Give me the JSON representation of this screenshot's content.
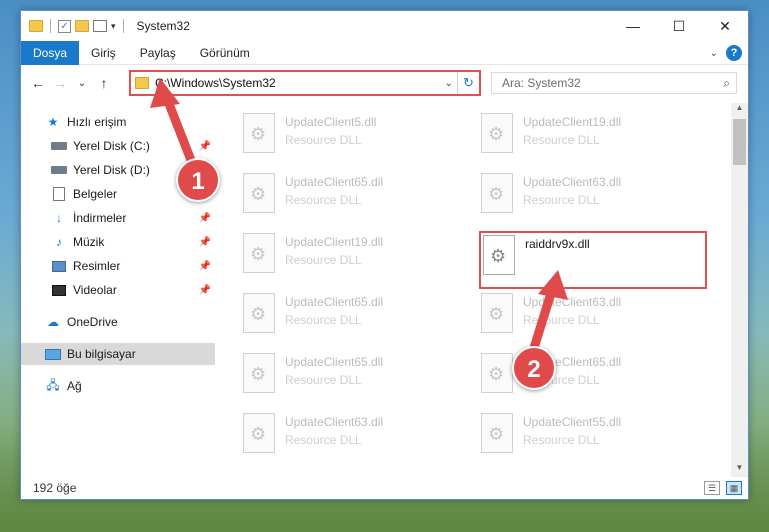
{
  "window": {
    "title": "System32"
  },
  "ribbon": {
    "tabs": [
      "Dosya",
      "Giriş",
      "Paylaş",
      "Görünüm"
    ]
  },
  "address": {
    "path": "C:\\Windows\\System32",
    "search_placeholder": "Ara: System32"
  },
  "sidebar": {
    "items": [
      {
        "label": "Hızlı erişim",
        "icon": "star-icon",
        "pinned": false
      },
      {
        "label": "Yerel Disk (C:)",
        "icon": "drive-icon",
        "pinned": true
      },
      {
        "label": "Yerel Disk (D:)",
        "icon": "drive-icon",
        "pinned": false
      },
      {
        "label": "Belgeler",
        "icon": "document-icon",
        "pinned": false
      },
      {
        "label": "İndirmeler",
        "icon": "download-icon",
        "pinned": true
      },
      {
        "label": "Müzik",
        "icon": "music-icon",
        "pinned": true
      },
      {
        "label": "Resimler",
        "icon": "pictures-icon",
        "pinned": true
      },
      {
        "label": "Videolar",
        "icon": "video-icon",
        "pinned": true
      },
      {
        "label": "OneDrive",
        "icon": "cloud-icon",
        "pinned": false
      },
      {
        "label": "Bu bilgisayar",
        "icon": "computer-icon",
        "pinned": false,
        "selected": true
      },
      {
        "label": "Ağ",
        "icon": "network-icon",
        "pinned": false
      }
    ]
  },
  "files": [
    {
      "name": "UpdateClient5.dll",
      "type": "Resource DLL"
    },
    {
      "name": "UpdateClient19.dll",
      "type": "Resource DLL"
    },
    {
      "name": "UpdateClient65.dll",
      "type": "Resource DLL"
    },
    {
      "name": "UpdateClient63.dll",
      "type": "Resource DLL"
    },
    {
      "name": "UpdateClient19.dll",
      "type": "Resource DLL"
    },
    {
      "name": "raiddrv9x.dll",
      "type": "",
      "highlighted": true
    },
    {
      "name": "UpdateClient65.dll",
      "type": "Resource DLL"
    },
    {
      "name": "UpdateClient63.dll",
      "type": "Resource DLL"
    },
    {
      "name": "UpdateClient65.dll",
      "type": "Resource DLL"
    },
    {
      "name": "UpdateClient65.dll",
      "type": "Resource DLL"
    },
    {
      "name": "UpdateClient63.dll",
      "type": "Resource DLL"
    },
    {
      "name": "UpdateClient55.dll",
      "type": "Resource DLL"
    }
  ],
  "status": {
    "item_count": "192 öğe"
  },
  "annotations": {
    "step1": "1",
    "step2": "2"
  },
  "colors": {
    "accent": "#1979ca",
    "highlight_red": "#e05050"
  }
}
